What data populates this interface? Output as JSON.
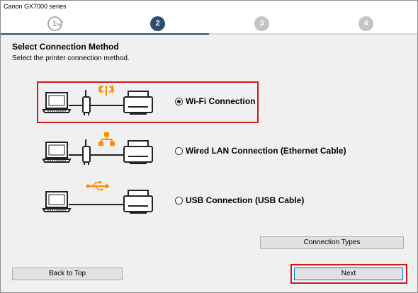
{
  "window": {
    "title": "Canon GX7000 series"
  },
  "steps": {
    "step2": "2",
    "step3": "3",
    "step4": "4",
    "progress_fraction": 0.5
  },
  "page": {
    "heading": "Select Connection Method",
    "subheading": "Select the printer connection method."
  },
  "options": [
    {
      "label": "Wi-Fi Connection",
      "selected": true,
      "icon": "wifi-icon"
    },
    {
      "label": "Wired LAN Connection (Ethernet Cable)",
      "selected": false,
      "icon": "lan-icon"
    },
    {
      "label": "USB Connection (USB Cable)",
      "selected": false,
      "icon": "usb-icon"
    }
  ],
  "buttons": {
    "connection_types": "Connection Types",
    "back_to_top": "Back to Top",
    "next": "Next"
  },
  "colors": {
    "accent": "#2c4e73",
    "highlight": "#d11a1a",
    "icon_orange": "#ff8c00"
  }
}
